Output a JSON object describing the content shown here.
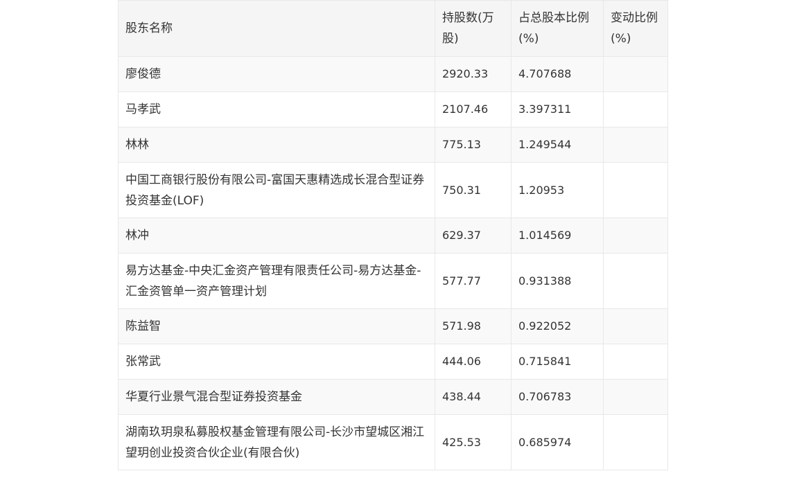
{
  "table": {
    "headers": [
      "股东名称",
      "持股数(万股)",
      "占总股本比例(%)",
      "变动比例(%)"
    ],
    "rows": [
      {
        "name": "廖俊德",
        "shares": "2920.33",
        "ratio": "4.707688",
        "change": ""
      },
      {
        "name": "马孝武",
        "shares": "2107.46",
        "ratio": "3.397311",
        "change": ""
      },
      {
        "name": "林林",
        "shares": "775.13",
        "ratio": "1.249544",
        "change": ""
      },
      {
        "name": "中国工商银行股份有限公司-富国天惠精选成长混合型证券投资基金(LOF)",
        "shares": "750.31",
        "ratio": "1.20953",
        "change": ""
      },
      {
        "name": "林冲",
        "shares": "629.37",
        "ratio": "1.014569",
        "change": ""
      },
      {
        "name": "易方达基金-中央汇金资产管理有限责任公司-易方达基金-汇金资管单一资产管理计划",
        "shares": "577.77",
        "ratio": "0.931388",
        "change": ""
      },
      {
        "name": "陈益智",
        "shares": "571.98",
        "ratio": "0.922052",
        "change": ""
      },
      {
        "name": "张常武",
        "shares": "444.06",
        "ratio": "0.715841",
        "change": ""
      },
      {
        "name": "华夏行业景气混合型证券投资基金",
        "shares": "438.44",
        "ratio": "0.706783",
        "change": ""
      },
      {
        "name": "湖南玖玥泉私募股权基金管理有限公司-长沙市望城区湘江望玥创业投资合伙企业(有限合伙)",
        "shares": "425.53",
        "ratio": "0.685974",
        "change": ""
      }
    ]
  }
}
